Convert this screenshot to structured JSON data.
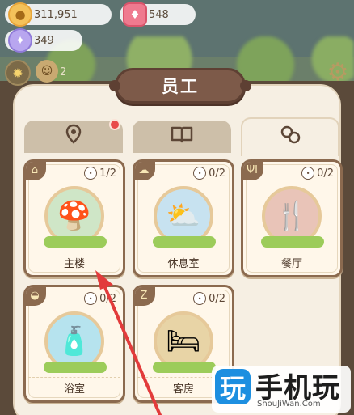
{
  "currencies": {
    "coin": {
      "value": "311,951",
      "icon": "coin-icon"
    },
    "gem": {
      "value": "548",
      "icon": "gem-icon"
    },
    "crystal": {
      "value": "349",
      "icon": "crystal-icon"
    }
  },
  "side": {
    "count": "2"
  },
  "panel": {
    "title": "员工"
  },
  "tabs": [
    {
      "icon": "location-pin-icon",
      "has_notification": true
    },
    {
      "icon": "book-icon"
    },
    {
      "icon": "staff-icon",
      "active": true
    }
  ],
  "rooms": [
    {
      "label": "主楼",
      "count": "1/2",
      "icon": "house-icon"
    },
    {
      "label": "休息室",
      "count": "0/2",
      "icon": "cloud-icon"
    },
    {
      "label": "餐厅",
      "count": "0/2",
      "icon": "cutlery-icon"
    },
    {
      "label": "浴室",
      "count": "0/2",
      "icon": "bath-icon"
    },
    {
      "label": "客房",
      "count": "0/2",
      "icon": "bed-icon"
    }
  ],
  "watermark": {
    "logo": "玩",
    "text": "手机玩",
    "url": "ShouJiWan.Com"
  }
}
